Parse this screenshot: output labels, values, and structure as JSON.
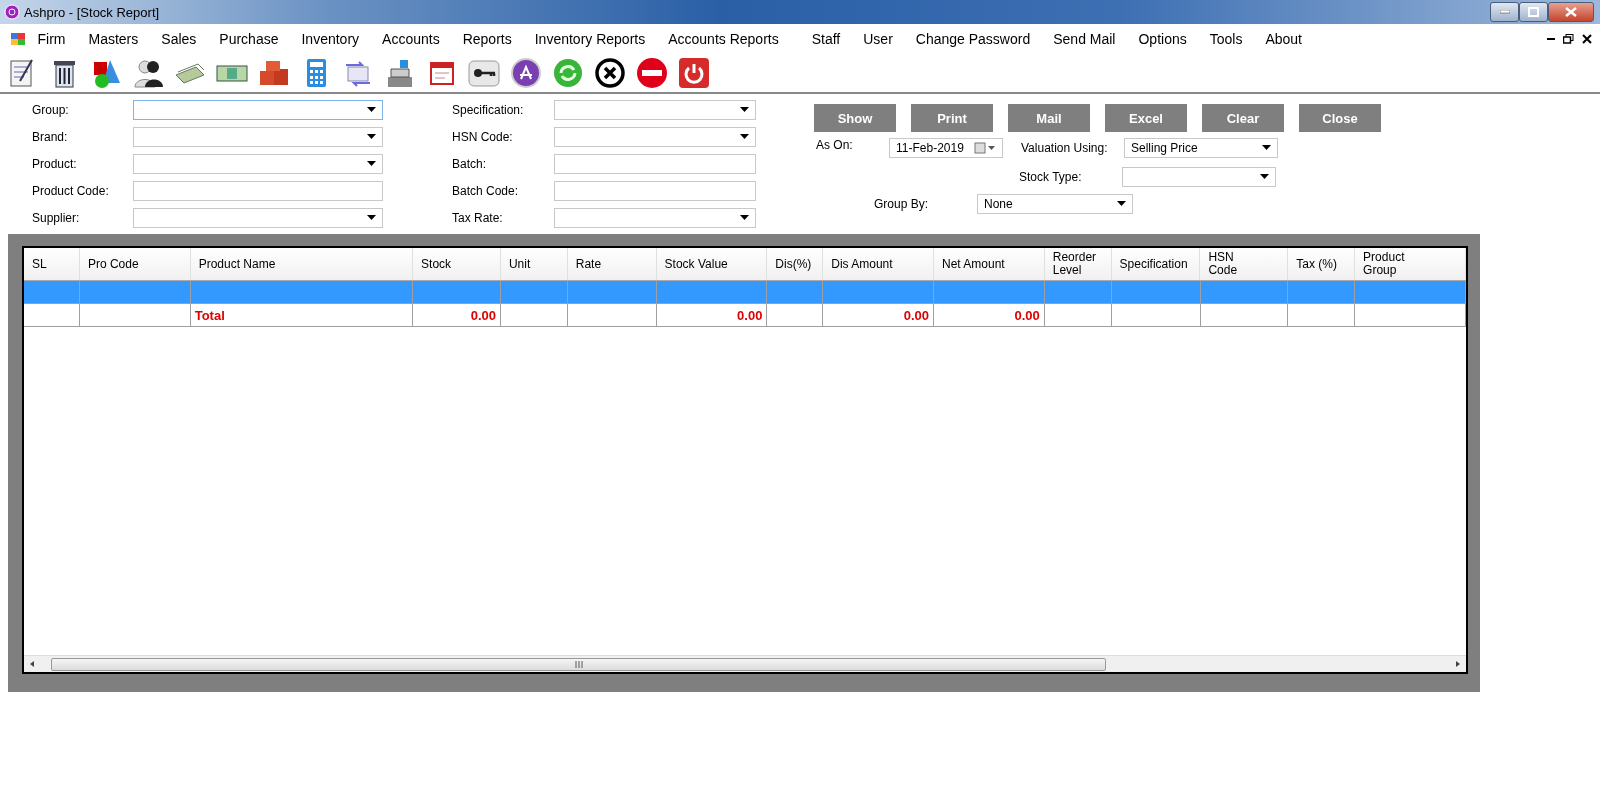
{
  "window": {
    "title": "Ashpro - [Stock Report]"
  },
  "menu": [
    "Firm",
    "Masters",
    "Sales",
    "Purchase",
    "Inventory",
    "Accounts",
    "Reports",
    "Inventory Reports",
    "Accounts Reports",
    "Staff",
    "User",
    "Change Password",
    "Send Mail",
    "Options",
    "Tools",
    "About"
  ],
  "filters_left": [
    {
      "label": "Group:",
      "kind": "combo",
      "focused": true
    },
    {
      "label": "Brand:",
      "kind": "combo",
      "focused": false
    },
    {
      "label": "Product:",
      "kind": "combo",
      "focused": false
    },
    {
      "label": "Product Code:",
      "kind": "text",
      "focused": false
    },
    {
      "label": "Supplier:",
      "kind": "combo",
      "focused": false
    }
  ],
  "filters_middle": [
    {
      "label": "Specification:",
      "kind": "combo",
      "focused": false
    },
    {
      "label": "HSN Code:",
      "kind": "combo",
      "focused": false
    },
    {
      "label": "Batch:",
      "kind": "text",
      "focused": false
    },
    {
      "label": "Batch Code:",
      "kind": "text",
      "focused": false
    },
    {
      "label": "Tax Rate:",
      "kind": "combo",
      "focused": false
    }
  ],
  "buttons": [
    "Show",
    "Print",
    "Mail",
    "Excel",
    "Clear",
    "Close"
  ],
  "as_on": {
    "label": "As On:",
    "value": "11-Feb-2019"
  },
  "valuation": {
    "label": "Valuation Using:",
    "value": "Selling Price"
  },
  "stock_type": {
    "label": "Stock Type:"
  },
  "group_by": {
    "label": "Group By:",
    "value": "None"
  },
  "table": {
    "columns": [
      "SL",
      "Pro Code",
      "Product Name",
      "Stock",
      "Unit",
      "Rate",
      "Stock Value",
      "Dis(%)",
      "Dis Amount",
      "Net Amount",
      "Reorder Level",
      "Specification",
      "HSN Code",
      "Tax (%)",
      "Product Group"
    ],
    "rows": [
      {
        "selected": true,
        "cells": [
          null,
          null,
          null,
          null,
          null,
          null,
          null,
          null,
          null,
          null,
          null,
          null,
          null,
          null,
          null
        ]
      },
      {
        "selected": false,
        "cells": [
          null,
          null,
          "Total",
          "0.00",
          null,
          null,
          "0.00",
          null,
          "0.00",
          "0.00",
          null,
          null,
          null,
          null,
          null
        ]
      }
    ]
  }
}
